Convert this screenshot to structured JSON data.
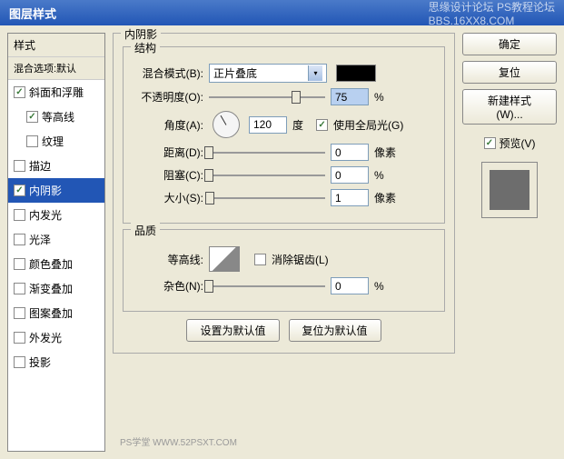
{
  "title": "图层样式",
  "watermark_right": "思缘设计论坛  PS教程论坛",
  "watermark_sub": "BBS.16XX8.COM",
  "left": {
    "styles_header": "样式",
    "blend_header": "混合选项:默认",
    "items": [
      {
        "label": "斜面和浮雕",
        "checked": true
      },
      {
        "label": "等高线",
        "checked": true,
        "indent": true
      },
      {
        "label": "纹理",
        "checked": false,
        "indent": true
      },
      {
        "label": "描边",
        "checked": false
      },
      {
        "label": "内阴影",
        "checked": true,
        "selected": true
      },
      {
        "label": "内发光",
        "checked": false
      },
      {
        "label": "光泽",
        "checked": false
      },
      {
        "label": "颜色叠加",
        "checked": false
      },
      {
        "label": "渐变叠加",
        "checked": false
      },
      {
        "label": "图案叠加",
        "checked": false
      },
      {
        "label": "外发光",
        "checked": false
      },
      {
        "label": "投影",
        "checked": false
      }
    ]
  },
  "mid": {
    "section_title": "内阴影",
    "structure_title": "结构",
    "blend_mode_label": "混合模式(B):",
    "blend_mode_value": "正片叠底",
    "opacity_label": "不透明度(O):",
    "opacity_value": "75",
    "opacity_unit": "%",
    "angle_label": "角度(A):",
    "angle_value": "120",
    "angle_unit": "度",
    "global_light": "使用全局光(G)",
    "distance_label": "距离(D):",
    "distance_value": "0",
    "distance_unit": "像素",
    "choke_label": "阻塞(C):",
    "choke_value": "0",
    "choke_unit": "%",
    "size_label": "大小(S):",
    "size_value": "1",
    "size_unit": "像素",
    "quality_title": "品质",
    "contour_label": "等高线:",
    "antialias": "消除锯齿(L)",
    "noise_label": "杂色(N):",
    "noise_value": "0",
    "noise_unit": "%",
    "btn_default": "设置为默认值",
    "btn_reset": "复位为默认值"
  },
  "right": {
    "ok": "确定",
    "cancel": "复位",
    "new_style": "新建样式(W)...",
    "preview": "预览(V)"
  },
  "footer": "PS学堂  WWW.52PSXT.COM"
}
